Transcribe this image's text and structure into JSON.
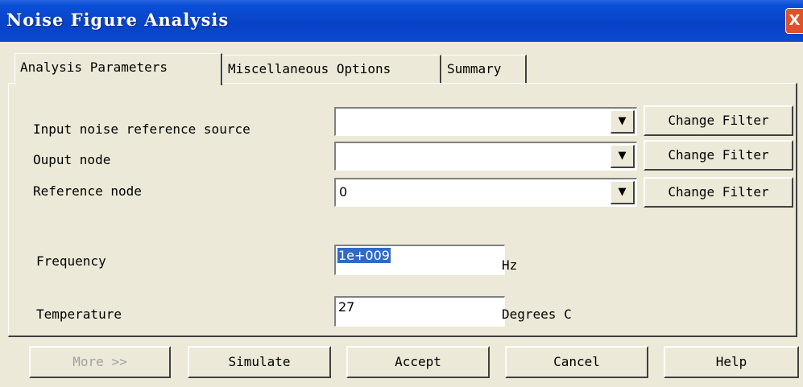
{
  "window": {
    "title": "Noise Figure Analysis",
    "close_glyph": "X"
  },
  "tabs": [
    {
      "label": "Analysis Parameters",
      "active": true
    },
    {
      "label": "Miscellaneous Options",
      "active": false
    },
    {
      "label": "Summary",
      "active": false
    }
  ],
  "params": {
    "input_source": {
      "label": "Input noise reference source",
      "value": "",
      "button": "Change Filter"
    },
    "output_node": {
      "label": "Ouput node",
      "value": "",
      "button": "Change Filter"
    },
    "reference_node": {
      "label": "Reference node",
      "value": "0",
      "button": "Change Filter"
    },
    "frequency": {
      "label": "Frequency",
      "value": "1e+009",
      "unit": "Hz"
    },
    "temperature": {
      "label": "Temperature",
      "value": "27",
      "unit": "Degrees C"
    }
  },
  "buttons": {
    "more": "More >>",
    "simulate": "Simulate",
    "accept": "Accept",
    "cancel": "Cancel",
    "help": "Help"
  },
  "icons": {
    "dropdown_arrow": "▼"
  }
}
